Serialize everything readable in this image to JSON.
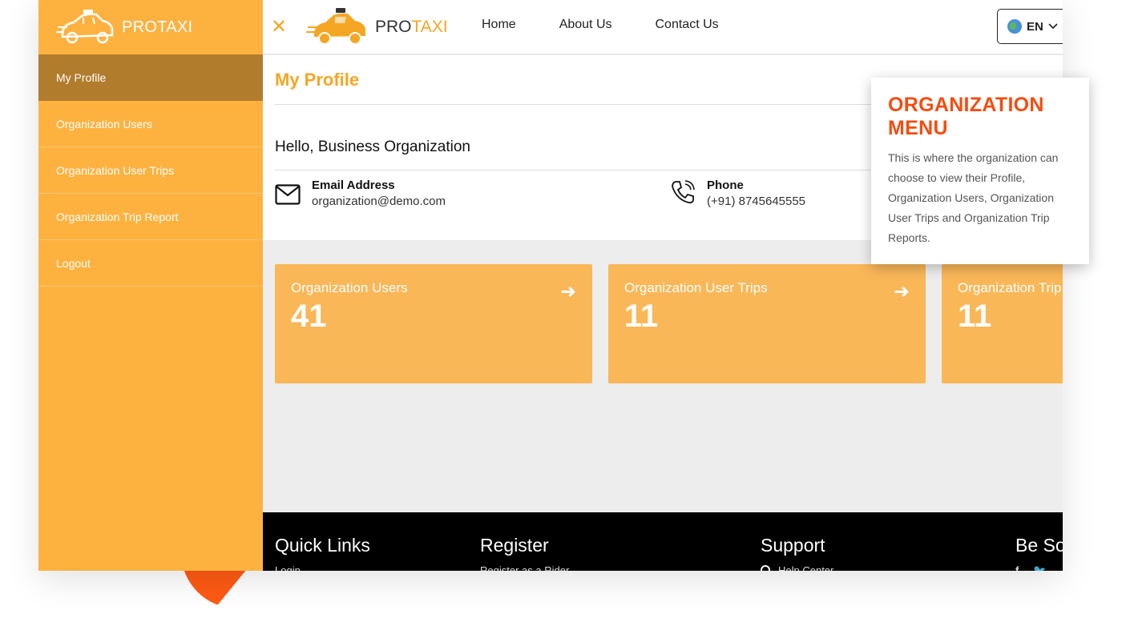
{
  "colors": {
    "brand_orange": "#fdb240",
    "accent_orange": "#f5a623",
    "sidebar_active": "#b17c2c",
    "card_bg": "#f9b758",
    "tooltip_title": "#f44d10"
  },
  "sidebar": {
    "brand": "PROTAXI",
    "items": [
      {
        "label": "My Profile"
      },
      {
        "label": "Organization Users"
      },
      {
        "label": "Organization User Trips"
      },
      {
        "label": "Organization Trip Report"
      },
      {
        "label": "Logout"
      }
    ]
  },
  "topbar": {
    "brand_a": "PRO",
    "brand_b": "TAXI",
    "nav": [
      {
        "label": "Home"
      },
      {
        "label": "About Us"
      },
      {
        "label": "Contact Us"
      }
    ],
    "language": "EN"
  },
  "profile": {
    "title": "My Profile",
    "greeting": "Hello, Business Organization",
    "email_label": "Email Address",
    "email_value": "organization@demo.com",
    "phone_label": "Phone",
    "phone_value": "(+91) 8745645555"
  },
  "cards": [
    {
      "title": "Organization Users",
      "value": "41"
    },
    {
      "title": "Organization User Trips",
      "value": "11"
    },
    {
      "title": "Organization Trip Report",
      "value": "11"
    }
  ],
  "footer": {
    "cols": [
      {
        "title": "Quick Links",
        "sub": "Login"
      },
      {
        "title": "Register",
        "sub": "Register as a Rider"
      },
      {
        "title": "Support",
        "sub": "Help Center"
      },
      {
        "title": "Be Social",
        "sub": ""
      }
    ]
  },
  "tooltip": {
    "title": "ORGANIZATION MENU",
    "body": "This is where the organization can choose to view their Profile, Organization Users, Organization User Trips and Organization Trip Reports."
  }
}
